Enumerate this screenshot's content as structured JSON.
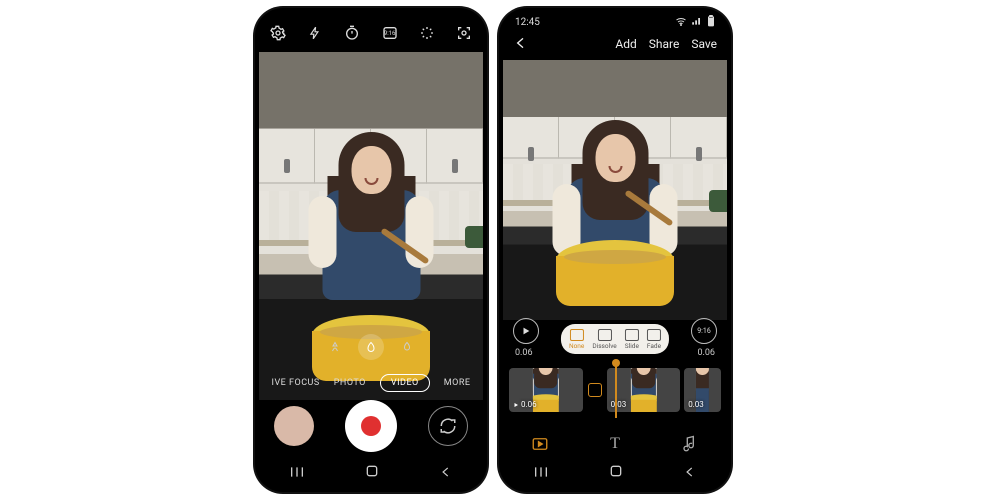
{
  "phone1": {
    "top_icons": [
      "settings",
      "flash",
      "timer",
      "ratio-9-16",
      "filters",
      "detect"
    ],
    "zoom": {
      "options": [
        "tree",
        "drop",
        "leaf"
      ],
      "selected": 1
    },
    "modes": {
      "left": "IVE FOCUS",
      "photo": "PHOTO",
      "selected": "VIDEO",
      "more": "MORE"
    },
    "shutter": {
      "type": "record"
    }
  },
  "phone2": {
    "status": {
      "time": "12:45"
    },
    "header": {
      "add": "Add",
      "share": "Share",
      "save": "Save"
    },
    "player": {
      "left_time": "0.06",
      "right_time": "0.06",
      "ratio_label": "9:16"
    },
    "transitions": [
      {
        "key": "none",
        "label": "None",
        "selected": true
      },
      {
        "key": "dissolve",
        "label": "Dissolve",
        "selected": false
      },
      {
        "key": "slide",
        "label": "Slide",
        "selected": false
      },
      {
        "key": "fade",
        "label": "Fade",
        "selected": false
      }
    ],
    "clips": [
      {
        "dur": "0.06"
      },
      {
        "dur": "0.03"
      },
      {
        "dur": "0.03"
      }
    ],
    "tools": [
      "video",
      "text",
      "music"
    ]
  }
}
